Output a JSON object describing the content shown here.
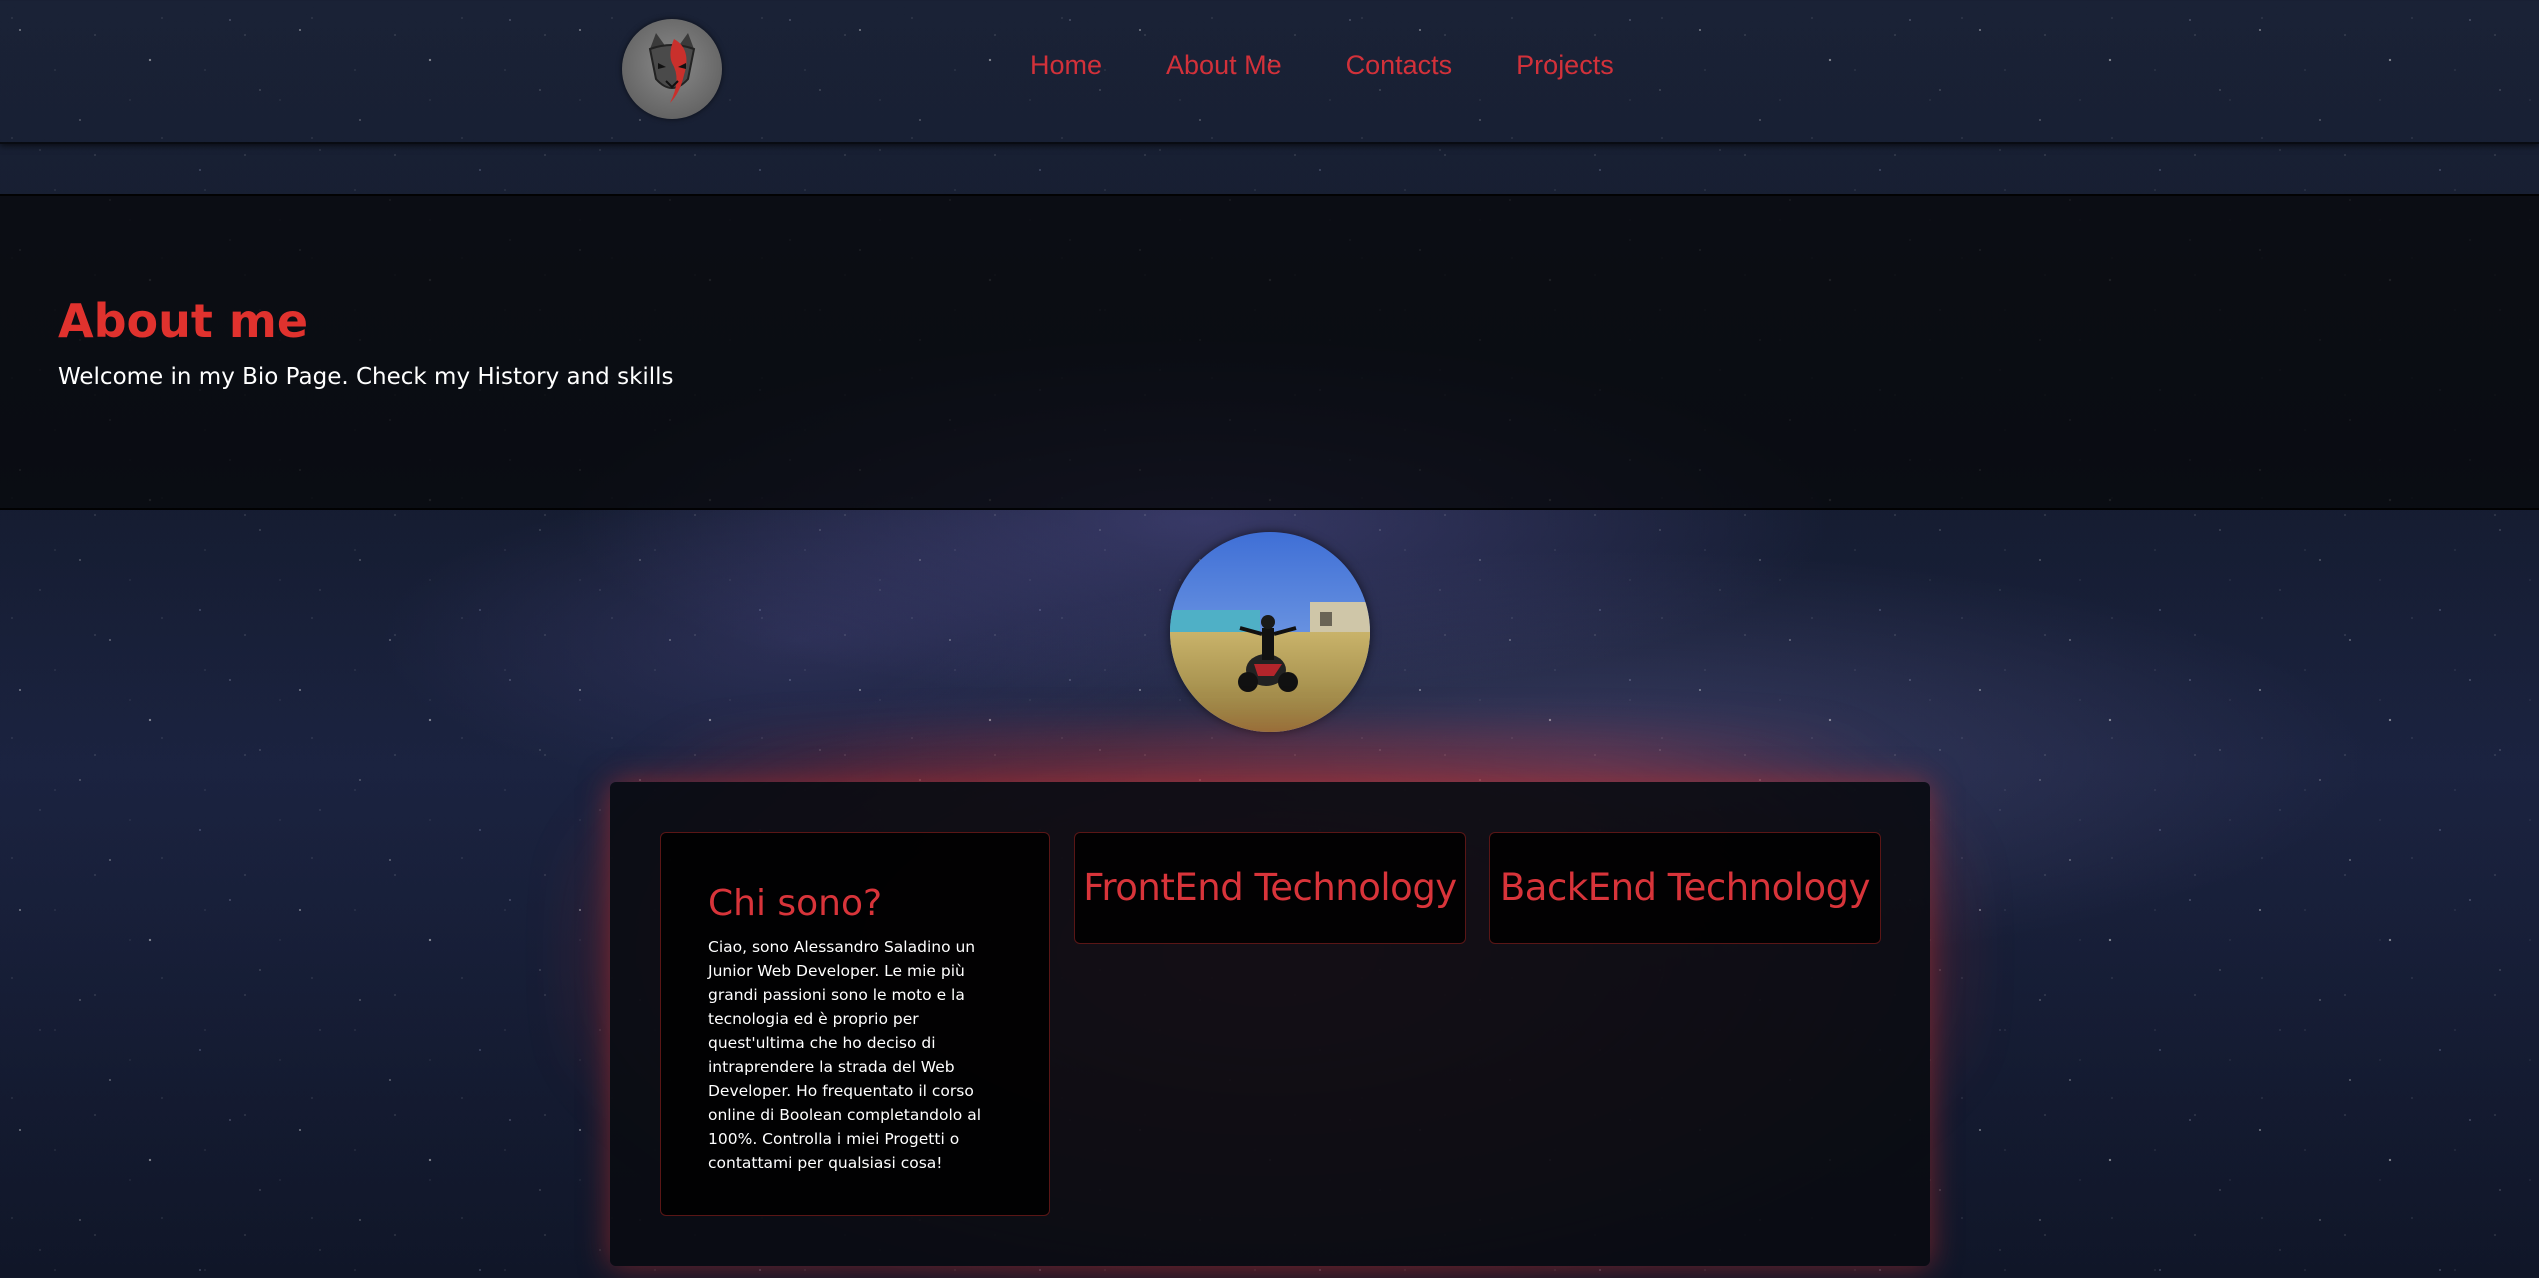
{
  "nav": {
    "logo_alt": "fox-logo",
    "links": [
      {
        "label": "Home"
      },
      {
        "label": "About Me"
      },
      {
        "label": "Contacts"
      },
      {
        "label": "Projects"
      }
    ]
  },
  "hero": {
    "title": "About me",
    "subtitle": "Welcome in my Bio Page. Check my History and skills"
  },
  "about": {
    "avatar": "profile-photo-motorcycle",
    "bio_card": {
      "title": "Chi sono?",
      "text": "Ciao, sono Alessandro Saladino un Junior Web Developer. Le mie più grandi passioni sono le moto e la tecnologia ed è proprio per quest'ultima che ho deciso di intraprendere la strada del Web Developer. Ho frequentato il corso online di Boolean completandolo al 100%. Controlla i miei Progetti o contattami per qualsiasi cosa!"
    },
    "frontend_card": {
      "title": "FrontEnd Technology"
    },
    "backend_card": {
      "title": "BackEnd Technology"
    }
  },
  "colors": {
    "accent": "#d2313a",
    "hero_title": "#e0322e",
    "background": "#141b2e"
  }
}
